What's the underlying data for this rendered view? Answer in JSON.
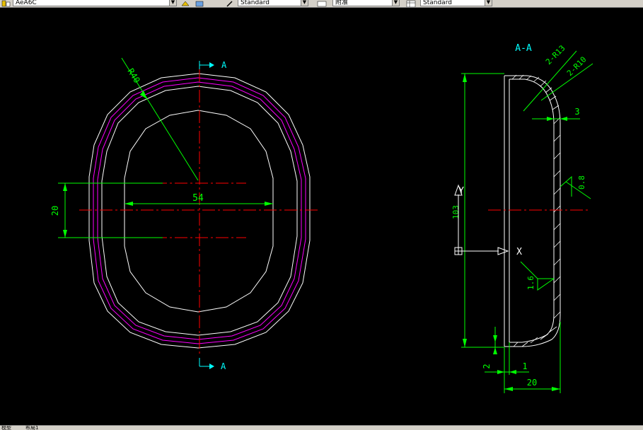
{
  "toolbar": {
    "layer_combo": "AeA6C",
    "text_style_combo": "Standard",
    "dim_style_combo": "附准",
    "table_style_combo": "Standard"
  },
  "drawing": {
    "front_view": {
      "section_marker_top": "A",
      "section_marker_bottom": "A",
      "radius_label": "R40",
      "width_label": "54",
      "height_label": "20"
    },
    "section_view": {
      "title": "A-A",
      "radius_label_outer": "2-R13",
      "radius_label_inner": "2-R10",
      "thickness_label": "3",
      "surface_finish_outer": "0.8",
      "height_label": "103",
      "surface_finish_inner": "1.6",
      "step_label": "2",
      "lip_label": "1",
      "depth_label": "20",
      "ucs_x_label": "X",
      "ucs_y_label": "Y"
    },
    "colors": {
      "dimension": "#00ff00",
      "centerline": "#ff0000",
      "outline": "#ffffff",
      "offset_profile": "#ff00ff",
      "section_marker": "#00ffff"
    }
  },
  "statusbar": {
    "model_tab": "模型",
    "layout_tab": "布局1"
  }
}
